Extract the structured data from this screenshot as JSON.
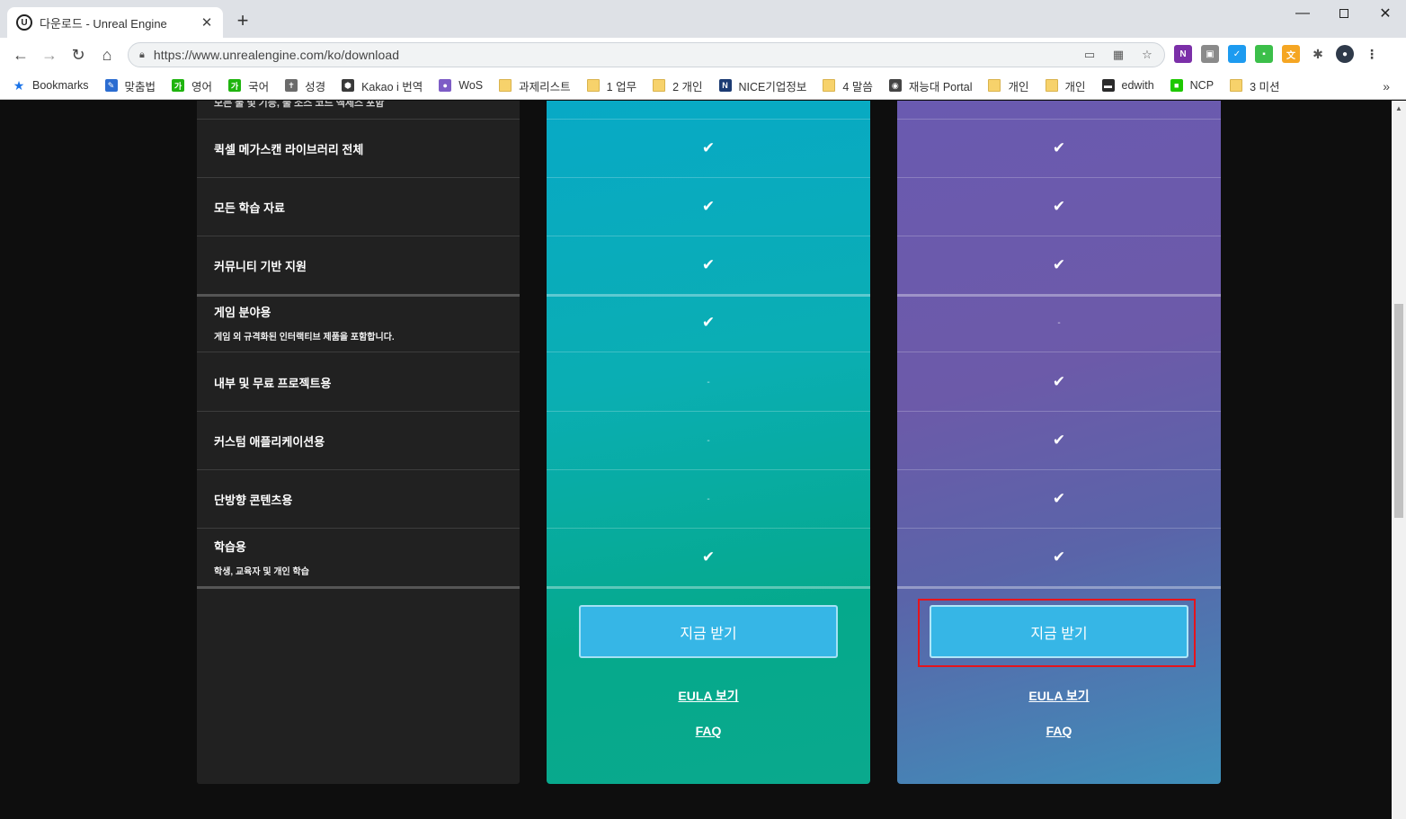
{
  "browser": {
    "tab_title": "다운로드 - Unreal Engine",
    "favicon": "U",
    "url": "https://www.unrealengine.com/ko/download",
    "bookmarks": [
      {
        "label": "Bookmarks",
        "icon": "star-icon",
        "color": "#1a73e8"
      },
      {
        "label": "맞춤법",
        "icon": "pen-icon",
        "color": "#2b6cd1"
      },
      {
        "label": "영어",
        "icon": "naver-dict-icon",
        "color": "#1fb40f"
      },
      {
        "label": "국어",
        "icon": "naver-dict-icon",
        "color": "#1fb40f"
      },
      {
        "label": "성경",
        "icon": "bible-icon",
        "color": "#6b6b6b"
      },
      {
        "label": "Kakao i 번역",
        "icon": "kakao-icon",
        "color": "#3a3a3a"
      },
      {
        "label": "WoS",
        "icon": "wos-icon",
        "color": "#7d5cc6"
      },
      {
        "label": "과제리스트",
        "icon": "folder-icon",
        "color": "#f7d26b"
      },
      {
        "label": "1 업무",
        "icon": "folder-icon",
        "color": "#f7d26b"
      },
      {
        "label": "2 개인",
        "icon": "folder-icon",
        "color": "#f7d26b"
      },
      {
        "label": "NICE기업정보",
        "icon": "nice-icon",
        "color": "#1c3b73"
      },
      {
        "label": "4 말씀",
        "icon": "folder-icon",
        "color": "#f7d26b"
      },
      {
        "label": "재능대 Portal",
        "icon": "globe-icon",
        "color": "#444444"
      },
      {
        "label": "개인",
        "icon": "folder-icon",
        "color": "#f7d26b"
      },
      {
        "label": "개인",
        "icon": "folder-icon",
        "color": "#f7d26b"
      },
      {
        "label": "edwith",
        "icon": "edwith-icon",
        "color": "#2b2b2b"
      },
      {
        "label": "NCP",
        "icon": "ncp-icon",
        "color": "#1ec800"
      },
      {
        "label": "3 미션",
        "icon": "folder-icon",
        "color": "#f7d26b"
      }
    ]
  },
  "features": {
    "top_clipped": "모든 툴 및 기능, 풀 소스 코드 액세스 포함",
    "rows": [
      {
        "label": "퀵셀 메가스캔 라이브러리 전체",
        "sub": ""
      },
      {
        "label": "모든 학습 자료",
        "sub": ""
      },
      {
        "label": "커뮤니티 기반 지원",
        "sub": ""
      },
      {
        "label": "게임 분야용",
        "sub": "게임 외 규격화된 인터랙티브 제품을 포함합니다."
      },
      {
        "label": "내부 및 무료 프로젝트용",
        "sub": ""
      },
      {
        "label": "커스텀 애플리케이션용",
        "sub": ""
      },
      {
        "label": "단방향 콘텐츠용",
        "sub": ""
      },
      {
        "label": "학습용",
        "sub": "학생, 교육자 및 개인 학습"
      }
    ]
  },
  "plans": [
    {
      "id": "publishing",
      "values": [
        "check",
        "check",
        "check",
        "check",
        "dash",
        "dash",
        "dash",
        "check"
      ],
      "button_label": "지금 받기",
      "eula_label": "EULA 보기",
      "faq_label": "FAQ"
    },
    {
      "id": "creators",
      "values": [
        "check",
        "check",
        "check",
        "dash",
        "check",
        "check",
        "check",
        "check"
      ],
      "button_label": "지금 받기",
      "eula_label": "EULA 보기",
      "faq_label": "FAQ"
    }
  ],
  "symbols": {
    "check": "✔",
    "dash": "-"
  },
  "colors": {
    "button": "#36b6e6",
    "highlight": "#e6141c",
    "plan_a_top": "#08a9c6",
    "plan_b_top": "#6a5ab0"
  }
}
